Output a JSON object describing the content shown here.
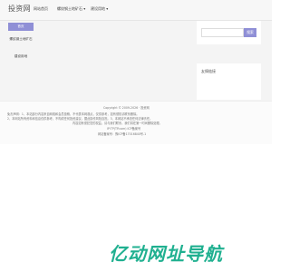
{
  "header": {
    "logo": "投资网",
    "nav": [
      {
        "label": "网站首页"
      },
      {
        "label": "螺纹钢土地矿石 ▾"
      },
      {
        "label": "建设用地 ▾"
      }
    ]
  },
  "sidebar": {
    "items": [
      {
        "label": "首页",
        "active": true
      },
      {
        "label": "螺纹钢土地矿石",
        "active": false
      },
      {
        "label": "建设用地",
        "active": false
      }
    ]
  },
  "search": {
    "placeholder": "",
    "button_label": "搜索"
  },
  "side_panel": {
    "title": "友情链接"
  },
  "footer": {
    "copyright": "Copyright © 2009-2026 · 投资网",
    "notice_lines": [
      "免责声明：1、本站部分内容来自网络和会员投稿，不代表本网观点，仅供参考，如有侵权请联系删除。",
      "2、本网站所有资料和信息仅供参考，不构成任何投资建议，据此操作风险自担。3、本网站不承担任何法律责任。",
      "内容如有侵犯您的权益，请与我们联系，我们将在第一时间删除处理。"
    ],
    "site": "IP:TP(TP.com) ICP备案号",
    "icp": "网站备案号：豫ICP备17016840号-1"
  },
  "watermark": {
    "text": "亿动网址导航"
  },
  "colors": {
    "accent": "#8f8fd6",
    "watermark": "#20b090"
  }
}
